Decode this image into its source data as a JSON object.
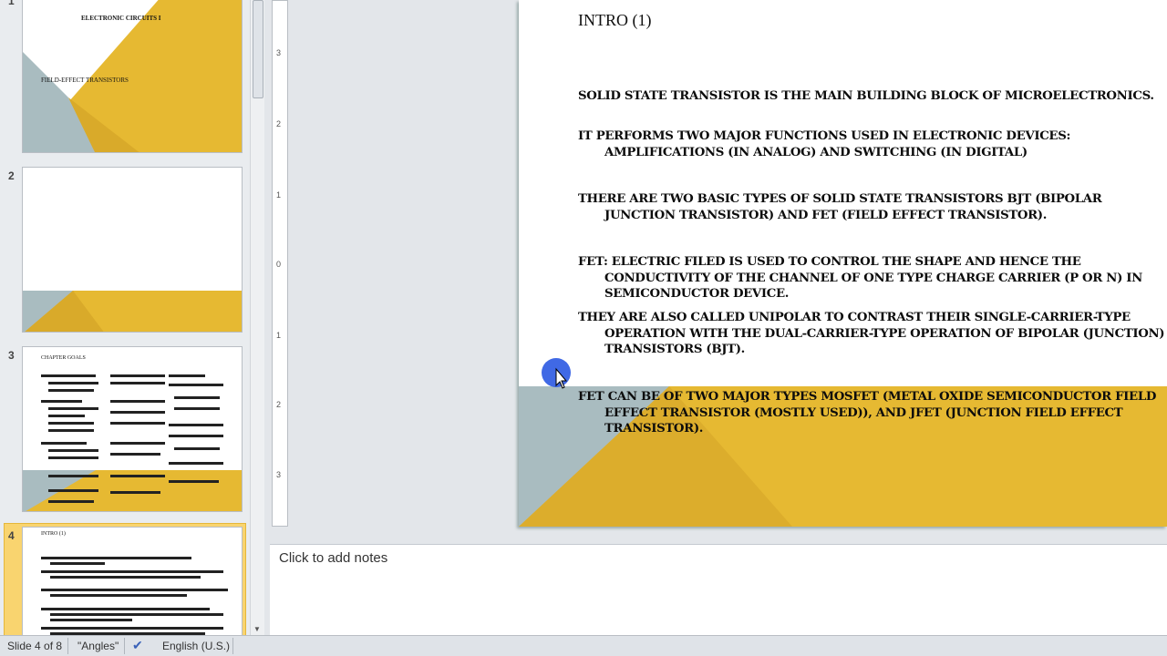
{
  "thumbnails": [
    {
      "number": "1",
      "title": "ELECTRONIC CIRCUITS I",
      "subtitle": "FIELD-EFFECT TRANSISTORS"
    },
    {
      "number": "2"
    },
    {
      "number": "3",
      "title": "CHAPTER GOALS"
    },
    {
      "number": "4",
      "title": "INTRO (1)"
    }
  ],
  "slide": {
    "title": "INTRO (1)",
    "bullets": [
      "SOLID STATE TRANSISTOR IS THE MAIN BUILDING BLOCK OF MICROELECTRONICS.",
      "IT PERFORMS TWO MAJOR FUNCTIONS USED IN ELECTRONIC DEVICES: AMPLIFICATIONS (IN ANALOG) AND SWITCHING (IN DIGITAL)",
      "THERE ARE TWO BASIC TYPES OF SOLID STATE TRANSISTORS BJT (BIPOLAR JUNCTION TRANSISTOR) AND FET (FIELD EFFECT TRANSISTOR).",
      "FET: ELECTRIC FILED IS USED TO CONTROL THE SHAPE AND HENCE THE CONDUCTIVITY OF THE CHANNEL OF ONE TYPE CHARGE CARRIER (P OR N)  IN SEMICONDUCTOR DEVICE.",
      "THEY ARE ALSO CALLED UNIPOLAR TO CONTRAST THEIR SINGLE-CARRIER-TYPE OPERATION WITH THE DUAL-CARRIER-TYPE OPERATION OF BIPOLAR (JUNCTION) TRANSISTORS (BJT).",
      "FET CAN BE OF TWO MAJOR TYPES MOSFET (METAL OXIDE SEMICONDUCTOR FIELD EFFECT TRANSISTOR (MOSTLY USED)), AND JFET (JUNCTION FIELD EFFECT TRANSISTOR)."
    ]
  },
  "ruler_labels": [
    "3",
    "2",
    "1",
    "0",
    "1",
    "2",
    "3"
  ],
  "notes": {
    "placeholder": "Click to add notes"
  },
  "status": {
    "slide": "Slide 4 of 8",
    "theme": "\"Angles\"",
    "language": "English (U.S.)"
  },
  "colors": {
    "yellow": "#e6b932",
    "gray_blue": "#a9bcc0"
  }
}
